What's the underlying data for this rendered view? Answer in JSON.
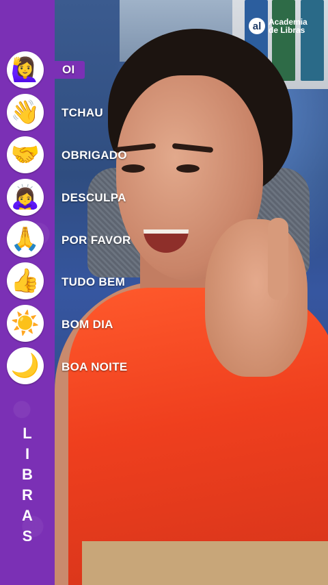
{
  "video": {
    "logo": {
      "line1": "Academia",
      "line2": "de Libras",
      "mark": "al"
    }
  },
  "sidebar": {
    "items": [
      {
        "emoji": "🙋‍♀️",
        "icon": "raising-hand-icon",
        "label": "OI",
        "active": true
      },
      {
        "emoji": "👋",
        "icon": "waving-hand-icon",
        "label": "TCHAU"
      },
      {
        "emoji": "🤝",
        "icon": "handshake-icon",
        "label": "OBRIGADO"
      },
      {
        "emoji": "🙇‍♀️",
        "icon": "bowing-person-icon",
        "label": "DESCULPA"
      },
      {
        "emoji": "🙏",
        "icon": "folded-hands-icon",
        "label": "POR FAVOR"
      },
      {
        "emoji": "👍",
        "icon": "thumbs-up-icon",
        "label": "TUDO BEM"
      },
      {
        "emoji": "☀️",
        "icon": "sun-icon",
        "label": "BOM DIA"
      },
      {
        "emoji": "🌙",
        "icon": "crescent-moon-icon",
        "label": "BOA NOITE"
      }
    ],
    "vertical_title": [
      "L",
      "I",
      "B",
      "R",
      "A",
      "S"
    ]
  },
  "colors": {
    "panel": "#7b30b5",
    "accent": "#ffffff"
  }
}
